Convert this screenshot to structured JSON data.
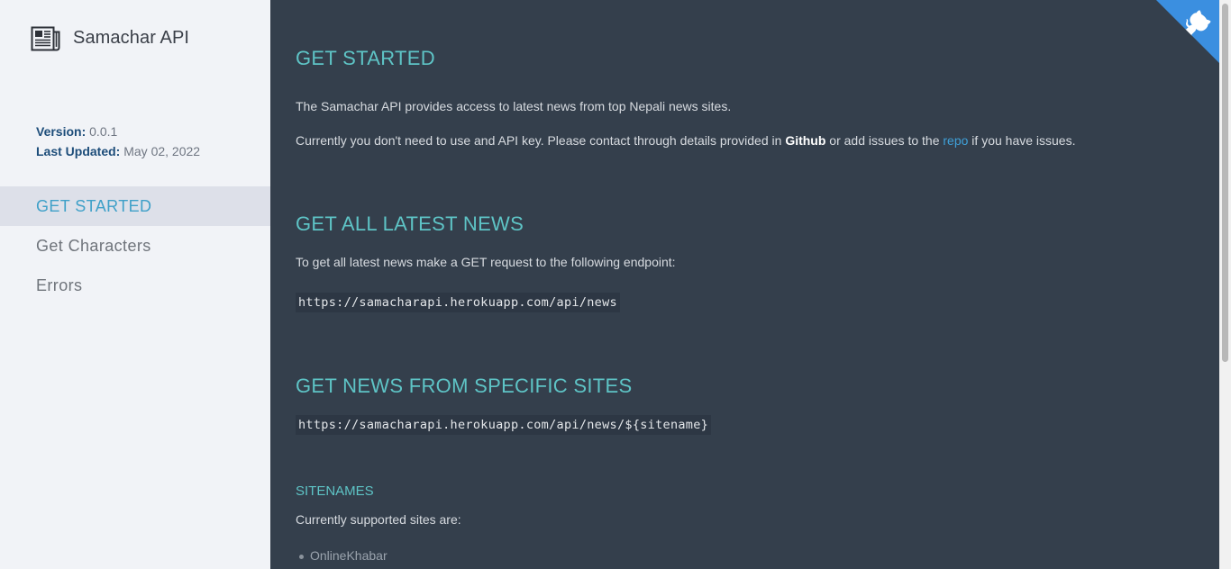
{
  "brand": {
    "title": "Samachar API",
    "icon": "newspaper-icon"
  },
  "meta": {
    "version_label": "Version:",
    "version_value": "0.0.1",
    "updated_label": "Last Updated:",
    "updated_value": "May 02, 2022"
  },
  "nav": {
    "items": [
      {
        "label": "GET STARTED",
        "active": true
      },
      {
        "label": "Get Characters",
        "active": false
      },
      {
        "label": "Errors",
        "active": false
      }
    ]
  },
  "content": {
    "get_started": {
      "heading": "GET STARTED",
      "intro": "The Samachar API provides access to latest news from top Nepali news sites.",
      "contact_prefix": "Currently you don't need to use and API key. Please contact through details provided in ",
      "contact_github": "Github",
      "contact_mid": " or add issues to the ",
      "contact_repo": "repo",
      "contact_suffix": " if you have issues."
    },
    "latest_news": {
      "heading": "GET ALL LATEST NEWS",
      "description": "To get all latest news make a GET request to the following endpoint:",
      "endpoint": "https://samacharapi.herokuapp.com/api/news"
    },
    "specific_sites": {
      "heading": "GET NEWS FROM SPECIFIC SITES",
      "endpoint": "https://samacharapi.herokuapp.com/api/news/${sitename}"
    },
    "sitenames": {
      "heading": "SITENAMES",
      "description": "Currently supported sites are:",
      "sites": [
        "OnlineKhabar"
      ]
    }
  },
  "github_corner": {
    "icon": "github-octocat-icon",
    "color": "#3b8fe0"
  },
  "colors": {
    "sidebar_bg": "#f1f3f7",
    "main_bg": "#343f4c",
    "heading": "#5ec4c6",
    "active_nav": "#3fa0c8"
  }
}
